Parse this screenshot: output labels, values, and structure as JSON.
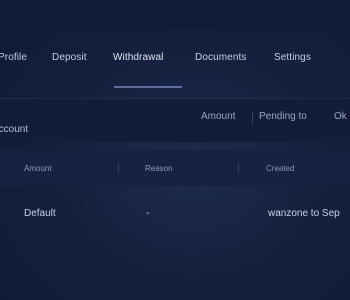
{
  "tabs": [
    {
      "label": "Profile"
    },
    {
      "label": "Deposit"
    },
    {
      "label": "Withdrawal",
      "active": true
    },
    {
      "label": "Documents"
    },
    {
      "label": "Settings"
    }
  ],
  "section": {
    "title": "Account",
    "filters": [
      "Amount",
      "Pending to",
      "Ok"
    ]
  },
  "table": {
    "headers": [
      "Amount",
      "Reason",
      "Created"
    ],
    "rows": [
      {
        "amount": "Default",
        "reason": "-",
        "created": "wanzone to Sep"
      }
    ]
  },
  "colors": {
    "background": "#16213f",
    "accent": "#5c6f9c",
    "text": "#c8d0e4"
  }
}
